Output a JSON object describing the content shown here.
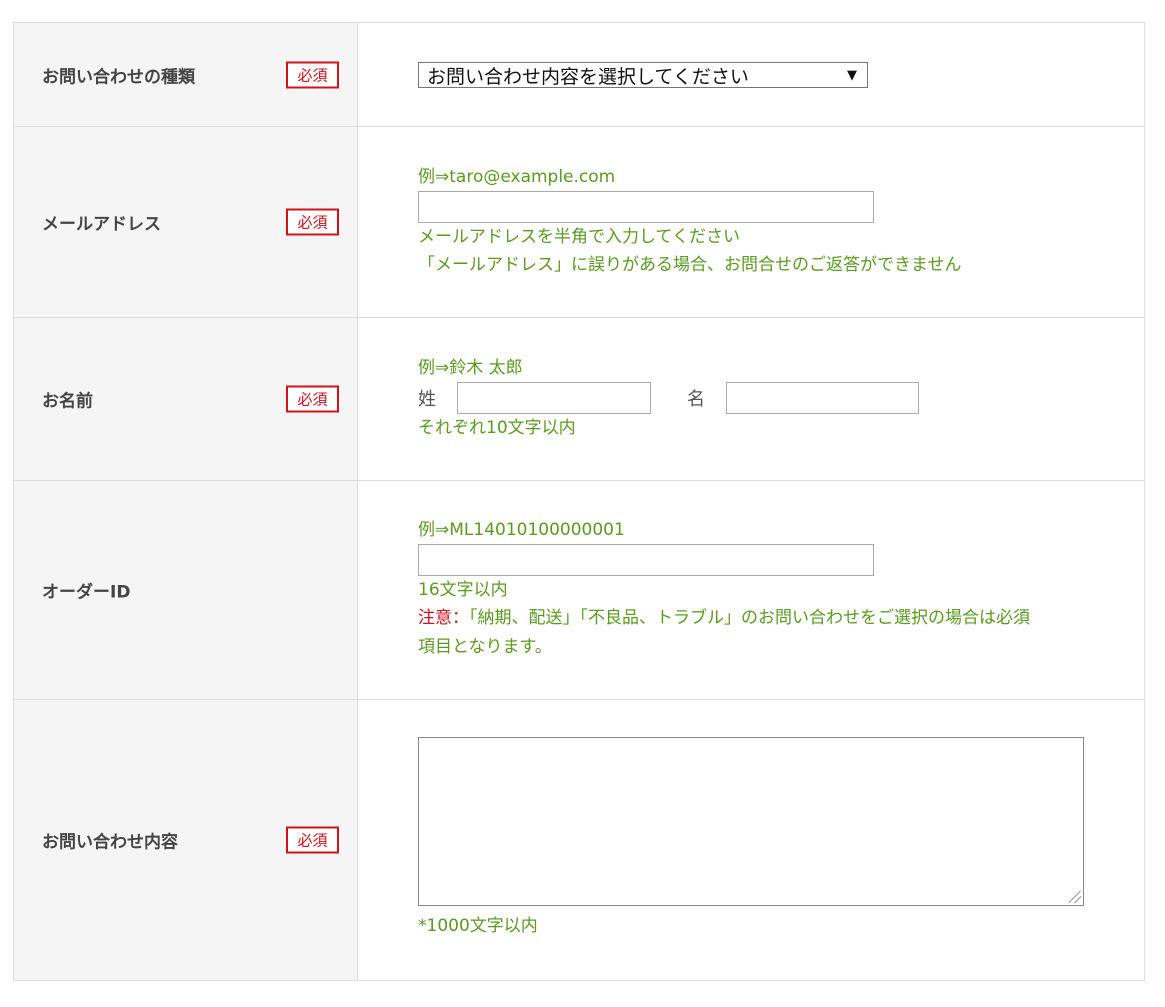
{
  "required_label": "必須",
  "rows": {
    "inquiry_type": {
      "label": "お問い合わせの種類",
      "select_value": "お問い合わせ内容を選択してください",
      "arrow": "▼"
    },
    "email": {
      "label": "メールアドレス",
      "example": "例⇒taro@example.com",
      "value": "",
      "hint1": "メールアドレスを半角で入力してください",
      "hint2": "「メールアドレス」に誤りがある場合、お問合せのご返答ができません"
    },
    "name": {
      "label": "お名前",
      "example": "例⇒鈴木 太郎",
      "last_label": "姓",
      "first_label": "名",
      "last_value": "",
      "first_value": "",
      "hint": "それぞれ10文字以内"
    },
    "order_id": {
      "label": "オーダーID",
      "example": "例⇒ML14010100000001",
      "value": "",
      "hint": "16文字以内",
      "note_prefix": "注意：",
      "note_body_line1": "「納期、配送」「不良品、トラブル」のお問い合わせをご選択の場合は必須",
      "note_body_line2": "項目となります。"
    },
    "content": {
      "label": "お問い合わせ内容",
      "value": "",
      "hint": "*1000文字以内"
    }
  },
  "colors": {
    "accent_green": "#5b9a1f",
    "required_red": "#d0121b",
    "header_bg": "#f5f5f5",
    "border": "#dddddd"
  }
}
